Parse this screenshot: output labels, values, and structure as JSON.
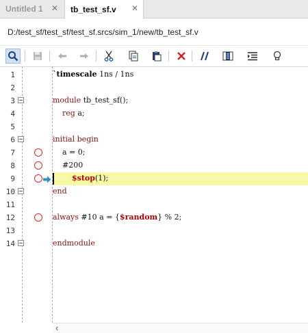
{
  "tabs": [
    {
      "label": "Untitled 1",
      "active": false
    },
    {
      "label": "tb_test_sf.v",
      "active": true
    }
  ],
  "file_path": "D:/test_sf/test_sf/test_sf.srcs/sim_1/new/tb_test_sf.v",
  "toolbar": {
    "icons": [
      "search-icon",
      "save-icon",
      "undo-icon",
      "redo-icon",
      "cut-icon",
      "copy-icon",
      "paste-icon",
      "delete-icon",
      "comment-icon",
      "column-icon",
      "indent-icon",
      "bulb-icon"
    ]
  },
  "editor": {
    "lines": [
      {
        "n": "1",
        "code": "`timescale 1ns / 1ns"
      },
      {
        "n": "2",
        "code": ""
      },
      {
        "n": "3",
        "code": "module tb_test_sf();"
      },
      {
        "n": "4",
        "code": "    reg a;"
      },
      {
        "n": "5",
        "code": ""
      },
      {
        "n": "6",
        "code": "initial begin"
      },
      {
        "n": "7",
        "code": "    a = 0;"
      },
      {
        "n": "8",
        "code": "    #200"
      },
      {
        "n": "9",
        "code": "        $stop(1);"
      },
      {
        "n": "10",
        "code": "end"
      },
      {
        "n": "11",
        "code": ""
      },
      {
        "n": "12",
        "code": "always #10 a = {$random} % 2;"
      },
      {
        "n": "13",
        "code": ""
      },
      {
        "n": "14",
        "code": "endmodule"
      }
    ],
    "breakpoint_lines": [
      "7",
      "8",
      "9",
      "12"
    ],
    "current_line": "9",
    "fold_lines": [
      "3",
      "6",
      "10",
      "14"
    ]
  },
  "colors": {
    "keyword": "#8a1010",
    "highlight": "#f8f8a6",
    "breakpoint": "#d42a2a",
    "arrow": "#2f8fbf"
  }
}
